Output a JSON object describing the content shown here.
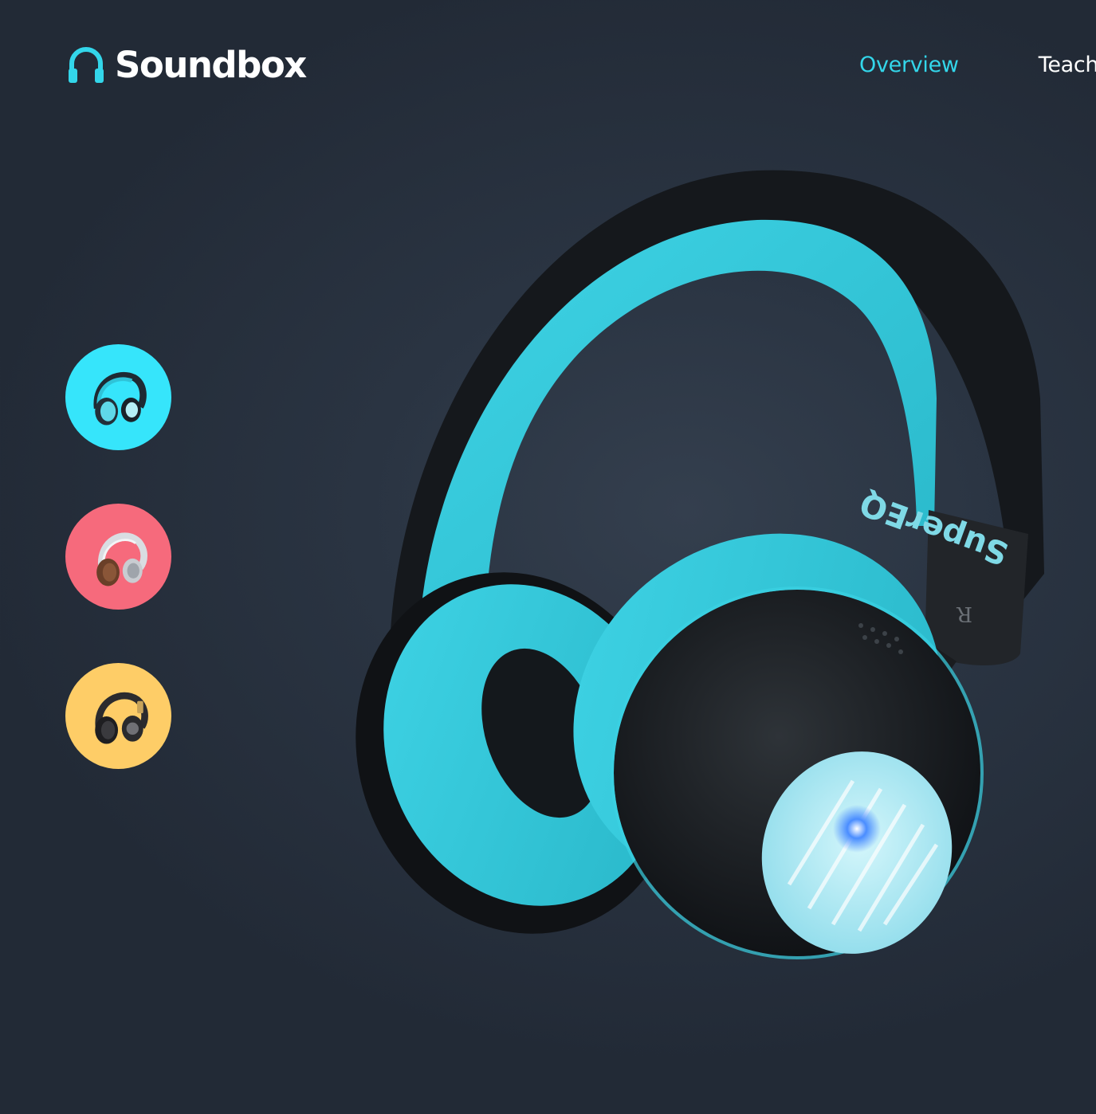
{
  "brand": {
    "name": "Soundbox",
    "icon": "headphones-icon",
    "accent_color": "#33d6ea"
  },
  "nav": {
    "items": [
      {
        "label": "Overview",
        "active": true
      },
      {
        "label": "Teach",
        "active": false
      }
    ]
  },
  "products": [
    {
      "name": "teal-headphones-thumb",
      "bg_color": "#36e5fb",
      "icon": "headphones-icon"
    },
    {
      "name": "pink-headphones-thumb",
      "bg_color": "#f66a7c",
      "icon": "headphones-icon"
    },
    {
      "name": "yellow-headphones-thumb",
      "bg_color": "#fecd67",
      "icon": "headphones-icon"
    }
  ],
  "hero": {
    "product_brand_text": "SuperEQ",
    "side_marker": "R"
  }
}
